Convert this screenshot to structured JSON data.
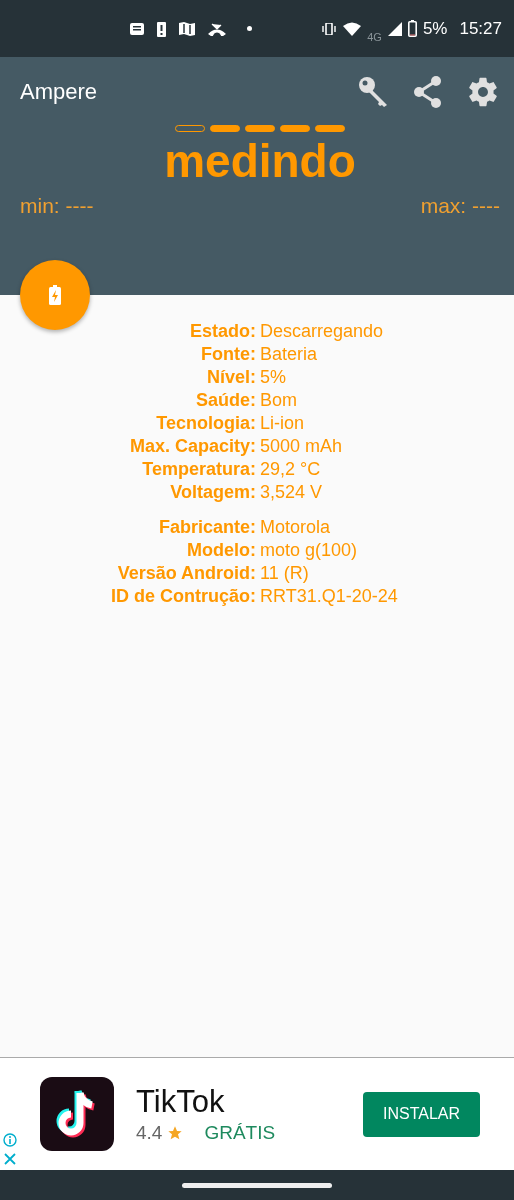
{
  "status_bar": {
    "battery_percent": "5%",
    "time": "15:27",
    "network": "4G"
  },
  "toolbar": {
    "title": "Ampere"
  },
  "indicator": [
    {
      "filled": false
    },
    {
      "filled": true
    },
    {
      "filled": true
    },
    {
      "filled": true
    },
    {
      "filled": true
    }
  ],
  "reading": "medindo",
  "min": "min: ----",
  "max": "max: ----",
  "groups": [
    {
      "rows": [
        {
          "label": "Estado:",
          "value": "Descarregando"
        },
        {
          "label": "Fonte:",
          "value": "Bateria"
        },
        {
          "label": "Nível:",
          "value": "5%"
        },
        {
          "label": "Saúde:",
          "value": "Bom"
        },
        {
          "label": "Tecnologia:",
          "value": "Li-ion"
        },
        {
          "label": "Max. Capacity:",
          "value": "5000 mAh"
        },
        {
          "label": "Temperatura:",
          "value": "29,2 °C"
        },
        {
          "label": "Voltagem:",
          "value": "3,524 V"
        }
      ]
    },
    {
      "rows": [
        {
          "label": "Fabricante:",
          "value": "Motorola"
        },
        {
          "label": "Modelo:",
          "value": "moto g(100)"
        },
        {
          "label": "Versão Android:",
          "value": "11 (R)"
        },
        {
          "label": "ID de Contrução:",
          "value": "RRT31.Q1-20-24"
        }
      ]
    }
  ],
  "ad": {
    "app_name": "TikTok",
    "rating": "4.4",
    "price": "GRÁTIS",
    "button": "INSTALAR"
  }
}
